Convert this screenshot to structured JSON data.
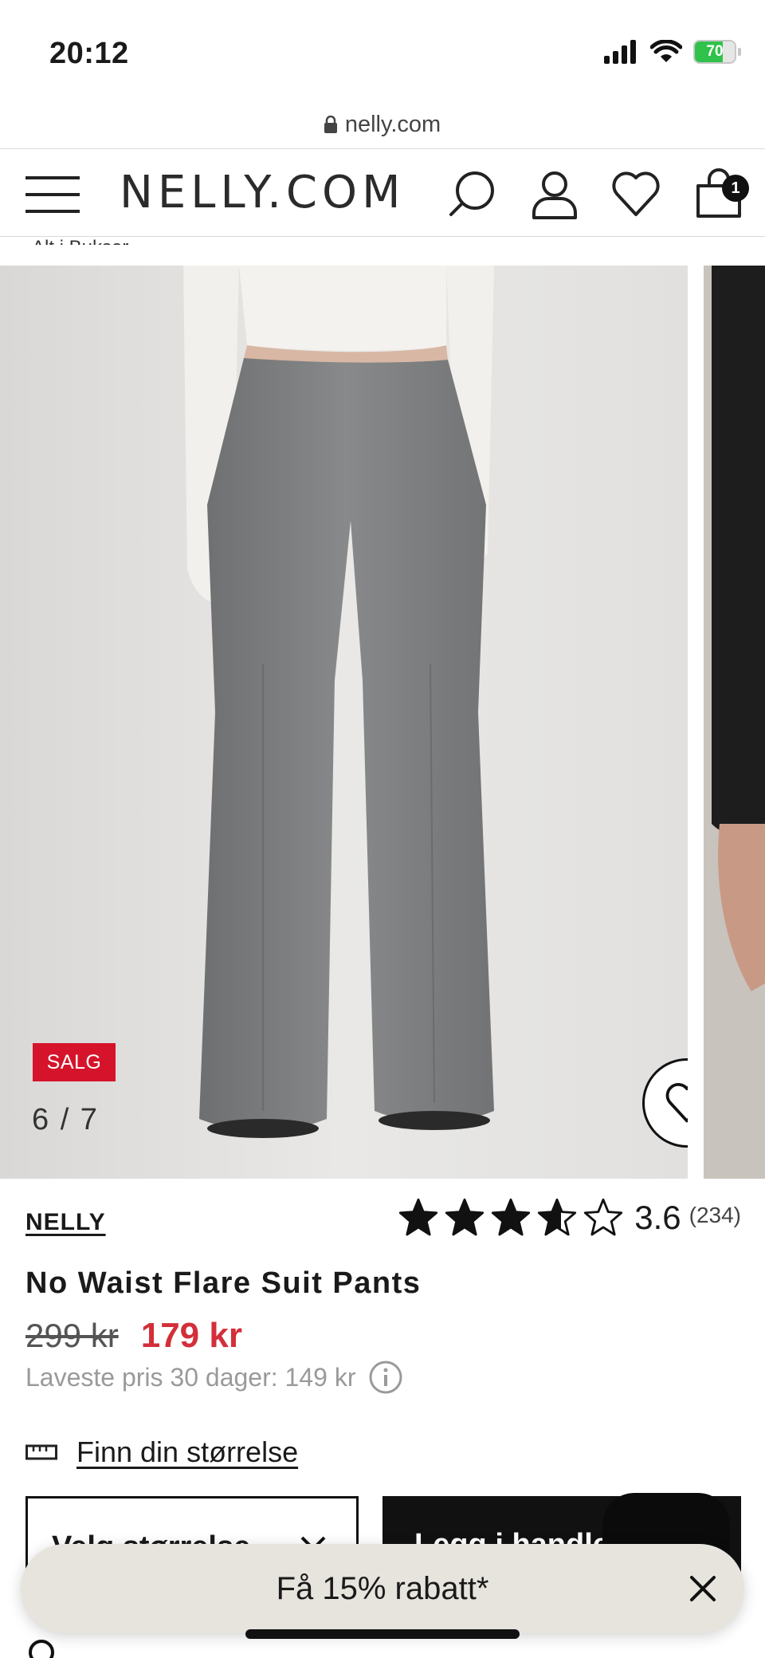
{
  "status_bar": {
    "time": "20:12",
    "battery_level": "70",
    "icons": [
      "cellular-signal-icon",
      "wifi-icon",
      "battery-charging-icon"
    ]
  },
  "browser": {
    "url": "nelly.com",
    "lock_icon": "lock-icon"
  },
  "header": {
    "logo": "NELLY.COM",
    "cart_count": "1",
    "icons": [
      "menu-icon",
      "search-icon",
      "account-icon",
      "wishlist-icon",
      "cart-icon"
    ]
  },
  "breadcrumb": {
    "label": "Alt i Bukser"
  },
  "gallery": {
    "badge": "SALG",
    "counter": "6 / 7",
    "current_image": 6,
    "total_images": 7
  },
  "product": {
    "brand": "NELLY",
    "title": "No Waist Flare Suit Pants",
    "old_price": "299 kr",
    "new_price": "179 kr",
    "lowest_price_note": "Laveste pris 30 dager: 149 kr",
    "rating_value": "3.6",
    "rating_count": "(234)",
    "rating_stars": 3.6
  },
  "size_guide": {
    "label": "Finn din størrelse"
  },
  "actions": {
    "size_select_label": "Velg størrelse",
    "add_to_bag_label": "Legg i handlekurv"
  },
  "promo": {
    "text": "Få 15% rabatt*"
  },
  "colors": {
    "sale_red": "#d5142b",
    "price_red": "#d32f3a",
    "battery_green": "#30c24b",
    "promo_bg": "#e6e4dd"
  }
}
